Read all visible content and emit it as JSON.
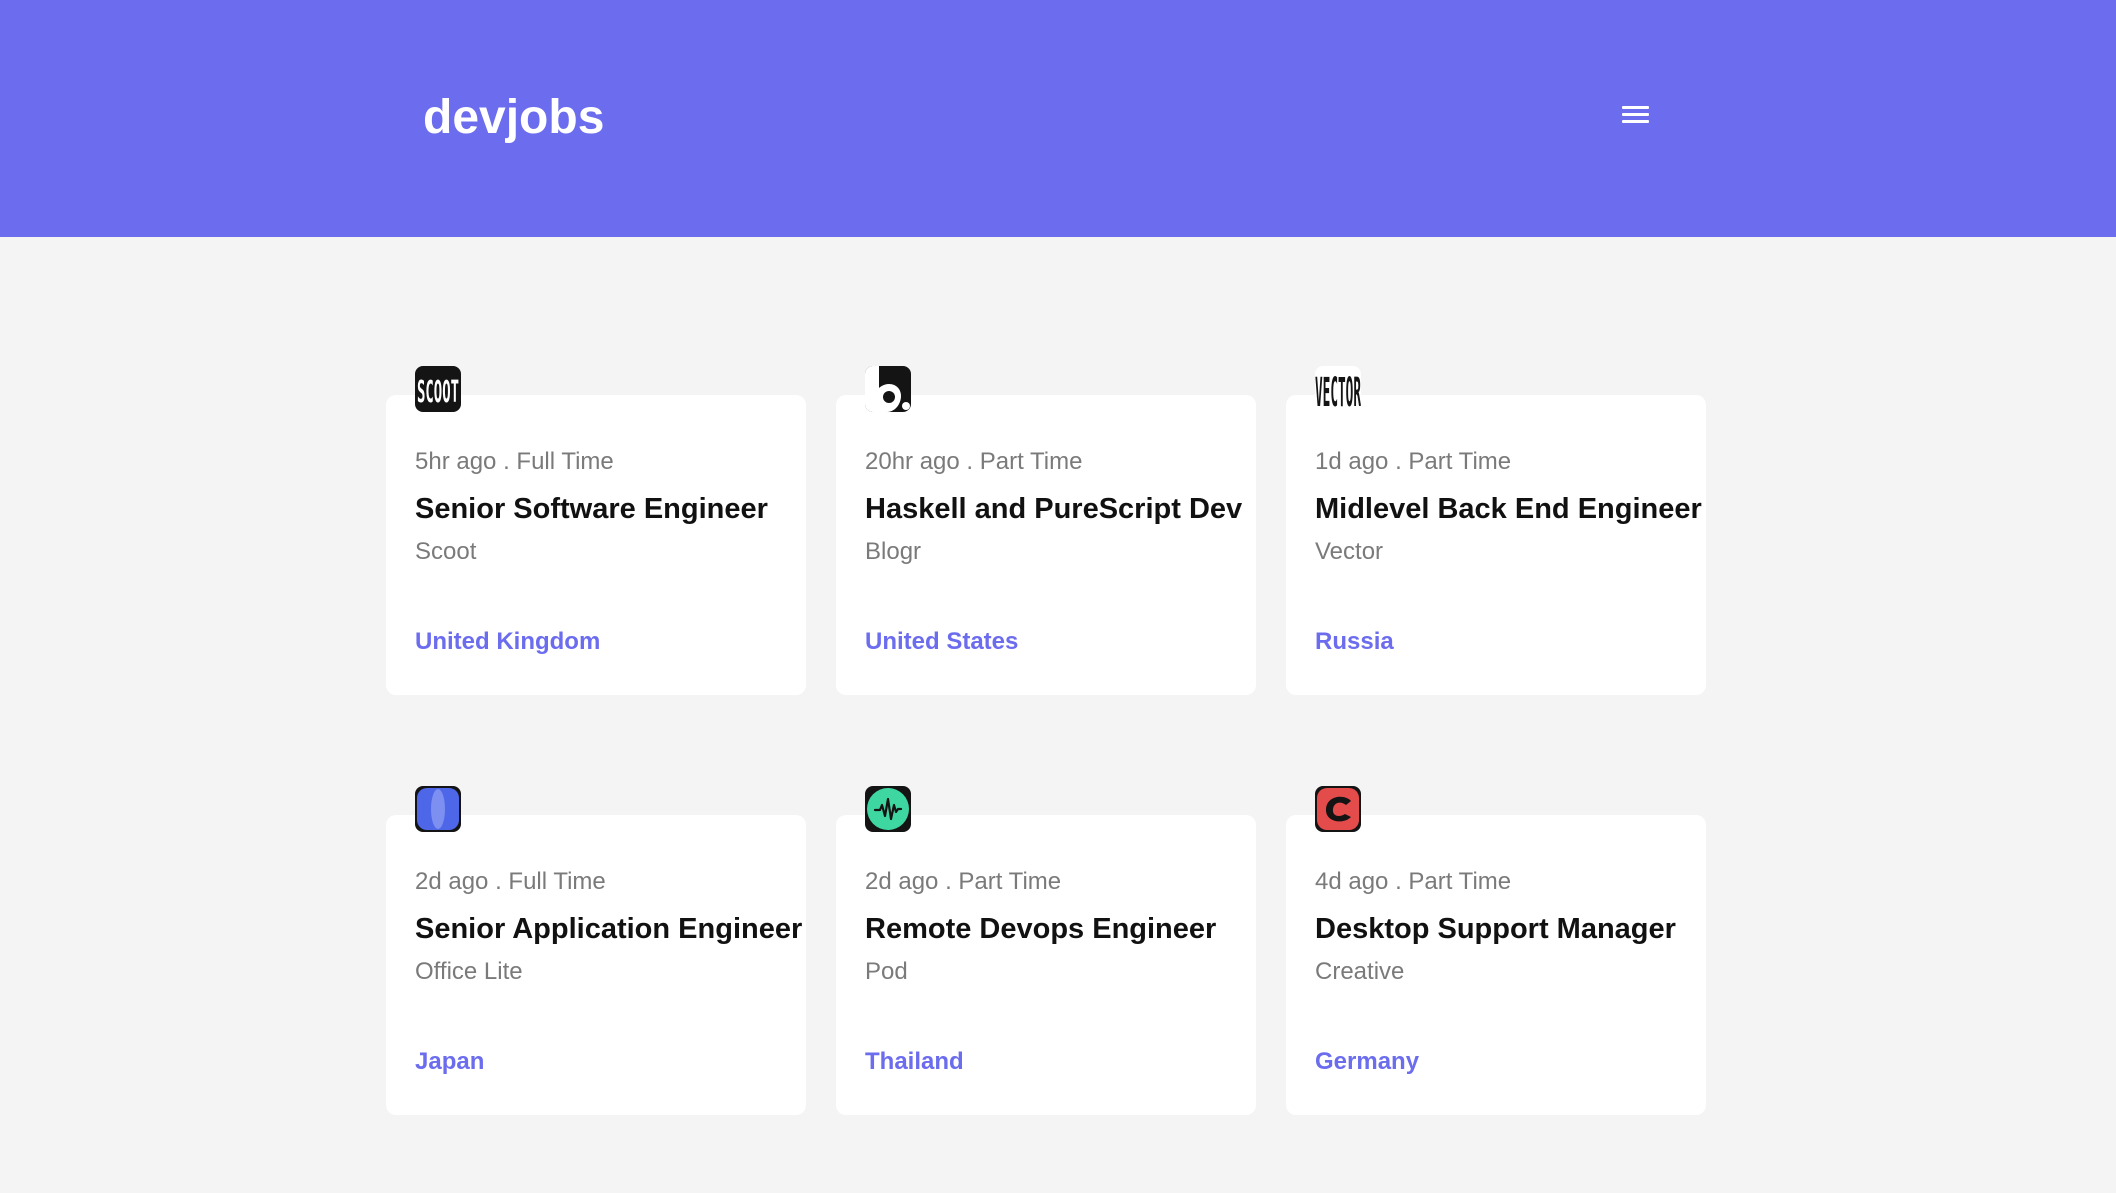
{
  "header": {
    "logo": "devjobs",
    "menu_icon": "hamburger-menu-icon",
    "background_color": "#6b6cee"
  },
  "jobs": [
    {
      "posted": "5hr ago",
      "contract": "Full Time",
      "title": "Senior Software Engineer",
      "company": "Scoot",
      "location": "United Kingdom",
      "logo": "scoot-logo",
      "logo_color": "#141414"
    },
    {
      "posted": "20hr ago",
      "contract": "Part Time",
      "title": "Haskell and PureScript Dev",
      "company": "Blogr",
      "location": "United States",
      "logo": "blogr-logo",
      "logo_color": "#141414"
    },
    {
      "posted": "1d ago",
      "contract": "Part Time",
      "title": "Midlevel Back End Engineer",
      "company": "Vector",
      "location": "Russia",
      "logo": "vector-logo",
      "logo_color": "#141414"
    },
    {
      "posted": "2d ago",
      "contract": "Full Time",
      "title": "Senior Application Engineer",
      "company": "Office Lite",
      "location": "Japan",
      "logo": "office-lite-logo",
      "logo_color": "#4d67e8"
    },
    {
      "posted": "2d ago",
      "contract": "Part Time",
      "title": "Remote Devops Engineer",
      "company": "Pod",
      "location": "Thailand",
      "logo": "pod-logo",
      "logo_color": "#3ed7a1"
    },
    {
      "posted": "4d ago",
      "contract": "Part Time",
      "title": "Desktop Support Manager",
      "company": "Creative",
      "location": "Germany",
      "logo": "creative-logo",
      "logo_color": "#e44b4b"
    }
  ],
  "separator": " . ",
  "accent_color": "#6b6cee"
}
